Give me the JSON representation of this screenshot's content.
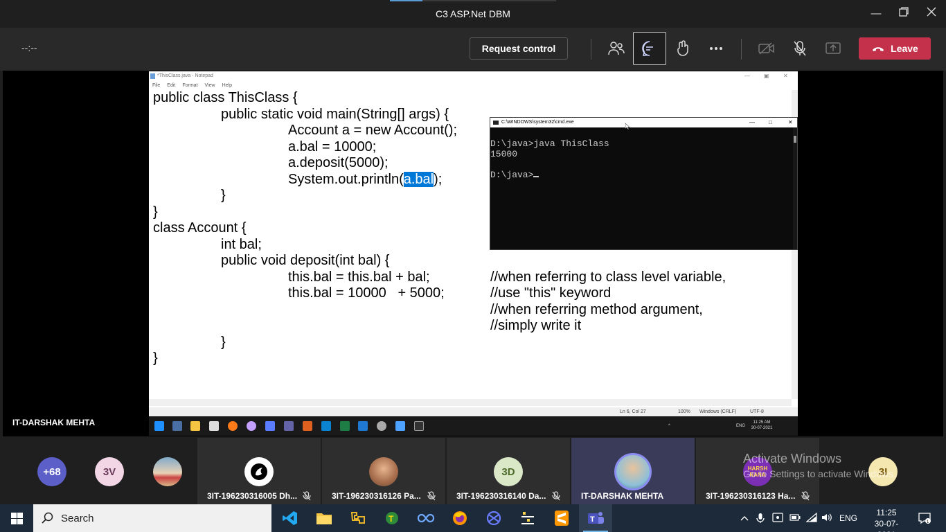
{
  "window": {
    "title": "C3 ASP.Net DBM"
  },
  "meeting": {
    "timer": "--:--",
    "request_control_label": "Request control",
    "leave_label": "Leave",
    "presenter_name": "IT-DARSHAK MEHTA"
  },
  "notepad": {
    "title": "*ThisClass.java - Notepad",
    "menu": [
      "File",
      "Edit",
      "Format",
      "View",
      "Help"
    ],
    "lines": [
      "public class ThisClass {",
      "public static void main(String[] args) {",
      "Account a = new Account();",
      "a.bal = 10000;",
      "a.deposit(5000);",
      "System.out.println(",
      "a.bal",
      ");",
      "}",
      "}",
      "class Account {",
      "int bal;",
      "public void deposit(int bal) {",
      "this.bal = this.bal + bal;",
      "//when referring to class level variable,",
      "this.bal = 10000   + 5000;",
      "//use \"this\" keyword",
      "//when referring method argument,",
      "//simply write it",
      "}",
      "}"
    ],
    "status": {
      "position": "Ln 6, Col 27",
      "zoom": "100%",
      "line_ending": "Windows (CRLF)",
      "encoding": "UTF-8"
    }
  },
  "cmd": {
    "title": "C:\\WINDOWS\\system32\\cmd.exe",
    "output": [
      "D:\\java>java ThisClass",
      "15000",
      "",
      "D:\\java>"
    ]
  },
  "remote_taskbar": {
    "lang": "ENG",
    "time": "11:25 AM",
    "date": "30-07-2021"
  },
  "participants": {
    "overflow_count": "+68",
    "avatar_3v": "3V",
    "tiles": [
      {
        "name": "3IT-196230316005 Dh..."
      },
      {
        "name": "3IT-196230316126 Pa..."
      },
      {
        "name": "3IT-196230316140 Da...",
        "initials": "3D"
      },
      {
        "name": "IT-DARSHAK MEHTA"
      },
      {
        "name": "3IT-196230316123 Ha...",
        "avatar_text": "HARSH RANA"
      }
    ],
    "avatar_3i": "3I"
  },
  "activation": {
    "line1": "Activate Windows",
    "line2": "Go to Settings to activate Windows."
  },
  "taskbar": {
    "search_placeholder": "Search",
    "lang": "ENG",
    "time": "11:25",
    "date": "30-07-2021"
  },
  "colors": {
    "leave": "#c4314b",
    "highlight": "#0078d7",
    "accent": "#5b9bd5"
  }
}
